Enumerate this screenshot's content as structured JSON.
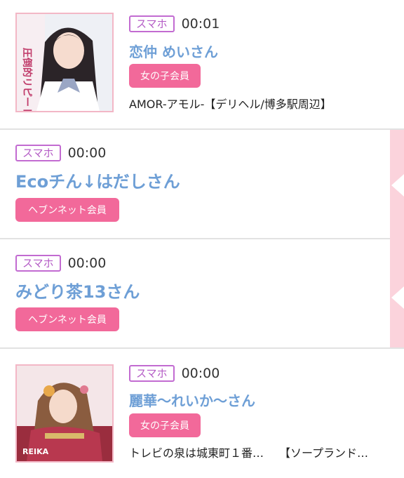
{
  "entries": [
    {
      "device": "スマホ",
      "time": "00:01",
      "name": "恋仲 めいさん",
      "badge": "女の子会員",
      "shop_name": "AMOR-アモル-",
      "shop_category": "【デリヘル/博多駅周辺】",
      "thumb_text": "圧倒的リピート"
    },
    {
      "device": "スマホ",
      "time": "00:00",
      "name": "Ecoチん↓はだしさん",
      "badge": "ヘブンネット会員"
    },
    {
      "device": "スマホ",
      "time": "00:00",
      "name": "みどり茶13さん",
      "badge": "ヘブンネット会員"
    },
    {
      "device": "スマホ",
      "time": "00:00",
      "name": "麗華〜れいか〜さん",
      "badge": "女の子会員",
      "shop_name": "トレビの泉は城東町１番…",
      "shop_category": "【ソープランド…",
      "thumb_text": "REIKA"
    }
  ],
  "colors": {
    "device_border": "#c26bd1",
    "name": "#6e9fd6",
    "badge": "#f2699a",
    "thumb_border": "#f3b7c6",
    "side_tab": "#fbd3dc"
  }
}
